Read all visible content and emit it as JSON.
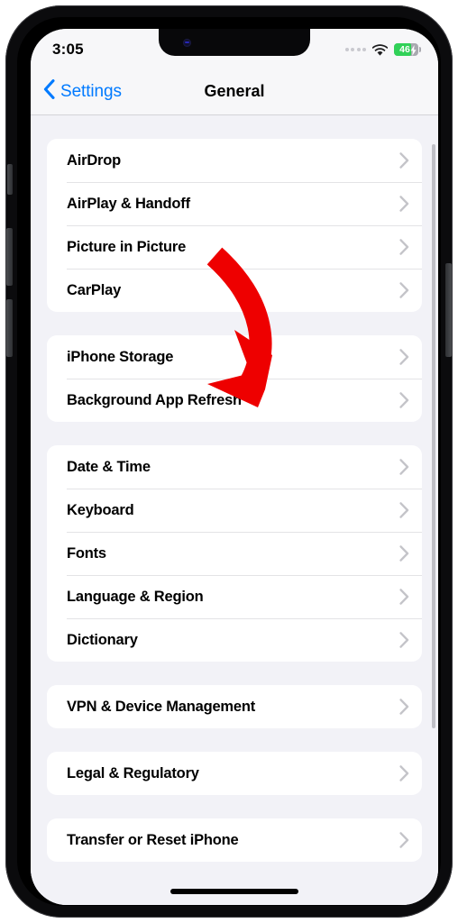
{
  "device": {
    "kind": "iphone",
    "hardware_buttons": [
      "mute-switch",
      "volume-up",
      "volume-down",
      "power-button"
    ],
    "frame_color": "#0b0b0d",
    "home_indicator": true
  },
  "status_bar": {
    "time": "3:05",
    "cellular_icon": "signal-dots-icon",
    "wifi_icon": "wifi-icon",
    "battery": {
      "level": "46",
      "charging": true,
      "fill_color": "#31d158",
      "bolt_icon": "lightning-bolt-icon"
    }
  },
  "nav_bar": {
    "back_icon": "chevron-left-icon",
    "back_label": "Settings",
    "title": "General",
    "accent_color": "#007aff"
  },
  "groups": [
    {
      "id": "connectivity",
      "rows": [
        {
          "label": "AirDrop",
          "accessory": "chevron-right-icon"
        },
        {
          "label": "AirPlay & Handoff",
          "accessory": "chevron-right-icon"
        },
        {
          "label": "Picture in Picture",
          "accessory": "chevron-right-icon"
        },
        {
          "label": "CarPlay",
          "accessory": "chevron-right-icon"
        }
      ]
    },
    {
      "id": "storage",
      "rows": [
        {
          "label": "iPhone Storage",
          "accessory": "chevron-right-icon"
        },
        {
          "label": "Background App Refresh",
          "accessory": "chevron-right-icon",
          "highlighted": true
        }
      ]
    },
    {
      "id": "localization",
      "rows": [
        {
          "label": "Date & Time",
          "accessory": "chevron-right-icon"
        },
        {
          "label": "Keyboard",
          "accessory": "chevron-right-icon"
        },
        {
          "label": "Fonts",
          "accessory": "chevron-right-icon"
        },
        {
          "label": "Language & Region",
          "accessory": "chevron-right-icon"
        },
        {
          "label": "Dictionary",
          "accessory": "chevron-right-icon"
        }
      ]
    },
    {
      "id": "management",
      "rows": [
        {
          "label": "VPN & Device Management",
          "accessory": "chevron-right-icon"
        }
      ]
    },
    {
      "id": "legal",
      "rows": [
        {
          "label": "Legal & Regulatory",
          "accessory": "chevron-right-icon"
        }
      ]
    },
    {
      "id": "reset",
      "rows": [
        {
          "label": "Transfer or Reset iPhone",
          "accessory": "chevron-right-icon"
        }
      ]
    }
  ],
  "annotation": {
    "type": "curved-arrow",
    "color": "#ee0000",
    "points_to": "Background App Refresh"
  },
  "scroll_indicator": {
    "visible": true,
    "color": "#bfbfc6"
  },
  "colors": {
    "screen_background": "#f2f2f7",
    "card_background": "#ffffff",
    "separator": "#e3e3e6",
    "chevron": "#c4c4c9",
    "label": "#000000"
  }
}
